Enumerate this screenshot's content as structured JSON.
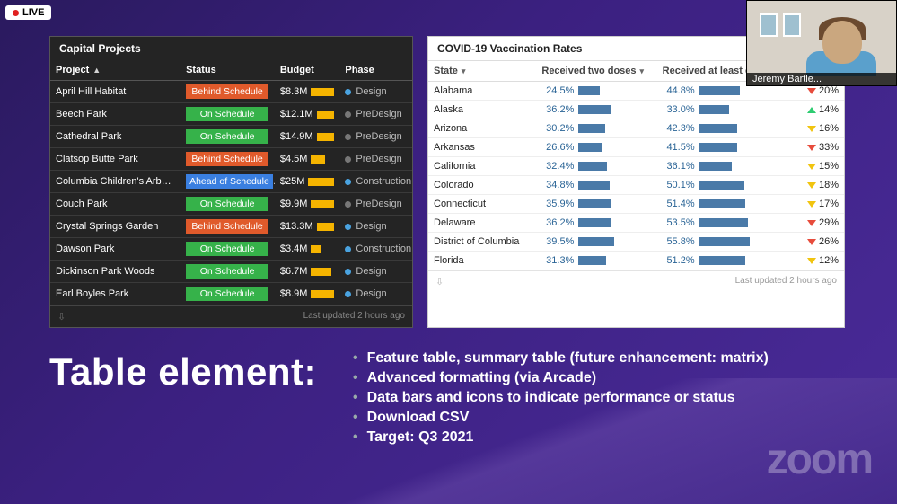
{
  "live_label": "LIVE",
  "webcam_name": "Jeremy Bartle...",
  "zoom_logo": "zoom",
  "panel1": {
    "title": "Capital Projects",
    "cols": {
      "project": "Project",
      "status": "Status",
      "budget": "Budget",
      "phase": "Phase"
    },
    "sort_glyph": "▲",
    "footer": "Last updated 2 hours ago",
    "rows": [
      {
        "p": "April Hill Habitat",
        "s": "Behind Schedule",
        "sc": "#e05a2b",
        "b": "$8.3M",
        "bw": 28,
        "ph": "Design",
        "pc": "#4aa3e0"
      },
      {
        "p": "Beech Park",
        "s": "On Schedule",
        "sc": "#36b24a",
        "b": "$12.1M",
        "bw": 42,
        "ph": "PreDesign",
        "pc": "#777"
      },
      {
        "p": "Cathedral Park",
        "s": "On Schedule",
        "sc": "#36b24a",
        "b": "$14.9M",
        "bw": 52,
        "ph": "PreDesign",
        "pc": "#777"
      },
      {
        "p": "Clatsop Butte Park",
        "s": "Behind Schedule",
        "sc": "#e05a2b",
        "b": "$4.5M",
        "bw": 16,
        "ph": "PreDesign",
        "pc": "#777"
      },
      {
        "p": "Columbia Children's Arboretum",
        "s": "Ahead of Schedule",
        "sc": "#3a7fe0",
        "b": "$25M",
        "bw": 78,
        "ph": "Construction",
        "pc": "#4aa3e0"
      },
      {
        "p": "Couch Park",
        "s": "On Schedule",
        "sc": "#36b24a",
        "b": "$9.9M",
        "bw": 34,
        "ph": "PreDesign",
        "pc": "#777"
      },
      {
        "p": "Crystal Springs Garden",
        "s": "Behind Schedule",
        "sc": "#e05a2b",
        "b": "$13.3M",
        "bw": 46,
        "ph": "Design",
        "pc": "#4aa3e0"
      },
      {
        "p": "Dawson Park",
        "s": "On Schedule",
        "sc": "#36b24a",
        "b": "$3.4M",
        "bw": 12,
        "ph": "Construction",
        "pc": "#4aa3e0"
      },
      {
        "p": "Dickinson Park Woods",
        "s": "On Schedule",
        "sc": "#36b24a",
        "b": "$6.7M",
        "bw": 23,
        "ph": "Design",
        "pc": "#4aa3e0"
      },
      {
        "p": "Earl Boyles Park",
        "s": "On Schedule",
        "sc": "#36b24a",
        "b": "$8.9M",
        "bw": 30,
        "ph": "Design",
        "pc": "#4aa3e0"
      }
    ]
  },
  "panel2": {
    "title": "COVID-19 Vaccination Rates",
    "cols": {
      "state": "State",
      "two": "Received two doses",
      "one": "Received at least one dose"
    },
    "sort_glyph": "▾",
    "footer": "Last updated 2 hours ago",
    "rows": [
      {
        "st": "Alabama",
        "two": "24.5%",
        "tw": 24,
        "one": "44.8%",
        "ow": 45,
        "tr": "dn",
        "tv": "20%"
      },
      {
        "st": "Alaska",
        "two": "36.2%",
        "tw": 36,
        "one": "33.0%",
        "ow": 33,
        "tr": "up",
        "tv": "14%"
      },
      {
        "st": "Arizona",
        "two": "30.2%",
        "tw": 30,
        "one": "42.3%",
        "ow": 42,
        "tr": "fl",
        "tv": "16%"
      },
      {
        "st": "Arkansas",
        "two": "26.6%",
        "tw": 27,
        "one": "41.5%",
        "ow": 42,
        "tr": "dn",
        "tv": "33%"
      },
      {
        "st": "California",
        "two": "32.4%",
        "tw": 32,
        "one": "36.1%",
        "ow": 36,
        "tr": "fl",
        "tv": "15%"
      },
      {
        "st": "Colorado",
        "two": "34.8%",
        "tw": 35,
        "one": "50.1%",
        "ow": 50,
        "tr": "fl",
        "tv": "18%"
      },
      {
        "st": "Connecticut",
        "two": "35.9%",
        "tw": 36,
        "one": "51.4%",
        "ow": 51,
        "tr": "fl",
        "tv": "17%"
      },
      {
        "st": "Delaware",
        "two": "36.2%",
        "tw": 36,
        "one": "53.5%",
        "ow": 54,
        "tr": "dn",
        "tv": "29%"
      },
      {
        "st": "District of Columbia",
        "two": "39.5%",
        "tw": 40,
        "one": "55.8%",
        "ow": 56,
        "tr": "dn",
        "tv": "26%"
      },
      {
        "st": "Florida",
        "two": "31.3%",
        "tw": 31,
        "one": "51.2%",
        "ow": 51,
        "tr": "fl",
        "tv": "12%"
      }
    ]
  },
  "heading": "Table element:",
  "bullets": [
    "Feature table, summary table (future enhancement: matrix)",
    "Advanced formatting (via Arcade)",
    "Data bars and icons to indicate performance or status",
    "Download CSV",
    "Target: Q3 2021"
  ]
}
